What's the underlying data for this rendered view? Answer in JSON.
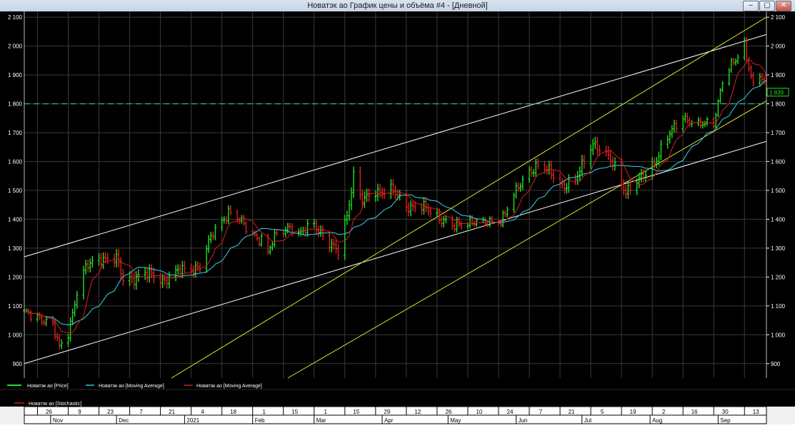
{
  "window": {
    "title": "Новатэк ао График цены и объёма #4 - [Дневной]",
    "buttons": {
      "minimize": "–",
      "restore": "▢",
      "close": "✕"
    }
  },
  "colors": {
    "background": "#000000",
    "grid": "#3a3a3a",
    "up_bar": "#22e022",
    "down_bar": "#e02020",
    "ma_fast": "#c81e1e",
    "ma_slow": "#33c3d6",
    "trend_white": "#ffffff",
    "trend_yellow": "#e3de2a",
    "level_line": "#2fb6b6"
  },
  "legend": {
    "price": "Новатэк ао [Price]",
    "ma_slow": "Новатэк ао [Moving Average]",
    "ma_fast": "Новатэк ао [Moving Average]"
  },
  "stochastic": {
    "label": "Новатэк ао [Stochastic]"
  },
  "chart_data": {
    "type": "ohlc",
    "ylim": [
      850,
      2120
    ],
    "y_ticks": [
      900,
      1000,
      1100,
      1200,
      1300,
      1400,
      1500,
      1600,
      1700,
      1800,
      1900,
      2000,
      2100
    ],
    "y_tick_labels": [
      "900",
      "1 000",
      "1 100",
      "1 200",
      "1 300",
      "1 400",
      "1 500",
      "1 600",
      "1 700",
      "1 800",
      "1 900",
      "2 000",
      "2 100"
    ],
    "last_price_label": "1 839",
    "last_price": 1839,
    "horizontal_level": 1800,
    "grid": true,
    "x_range": [
      "2020-10-20",
      "2021-09-23"
    ],
    "day_ticks": [
      {
        "date": "2020-10-26",
        "label": "26"
      },
      {
        "date": "2020-11-09",
        "label": "9"
      },
      {
        "date": "2020-11-23",
        "label": "23"
      },
      {
        "date": "2020-12-07",
        "label": "7"
      },
      {
        "date": "2020-12-21",
        "label": "21"
      },
      {
        "date": "2021-01-04",
        "label": "4"
      },
      {
        "date": "2021-01-18",
        "label": "18"
      },
      {
        "date": "2021-02-01",
        "label": "1"
      },
      {
        "date": "2021-02-15",
        "label": "15"
      },
      {
        "date": "2021-03-01",
        "label": "1"
      },
      {
        "date": "2021-03-15",
        "label": "15"
      },
      {
        "date": "2021-03-29",
        "label": "29"
      },
      {
        "date": "2021-04-12",
        "label": "12"
      },
      {
        "date": "2021-04-26",
        "label": "26"
      },
      {
        "date": "2021-05-10",
        "label": "10"
      },
      {
        "date": "2021-05-24",
        "label": "24"
      },
      {
        "date": "2021-06-07",
        "label": "7"
      },
      {
        "date": "2021-06-21",
        "label": "21"
      },
      {
        "date": "2021-07-05",
        "label": "5"
      },
      {
        "date": "2021-07-19",
        "label": "19"
      },
      {
        "date": "2021-08-02",
        "label": "2"
      },
      {
        "date": "2021-08-16",
        "label": "16"
      },
      {
        "date": "2021-08-30",
        "label": "30"
      },
      {
        "date": "2021-09-13",
        "label": "13"
      }
    ],
    "month_ticks": [
      {
        "date": "2020-11-01",
        "label": "Nov"
      },
      {
        "date": "2020-12-01",
        "label": "Dec"
      },
      {
        "date": "2021-01-01",
        "label": "2021"
      },
      {
        "date": "2021-02-01",
        "label": "Feb"
      },
      {
        "date": "2021-03-01",
        "label": "Mar"
      },
      {
        "date": "2021-04-01",
        "label": "Apr"
      },
      {
        "date": "2021-05-01",
        "label": "May"
      },
      {
        "date": "2021-06-01",
        "label": "Jun"
      },
      {
        "date": "2021-07-01",
        "label": "Jul"
      },
      {
        "date": "2021-08-01",
        "label": "Aug"
      },
      {
        "date": "2021-09-01",
        "label": "Sep"
      }
    ],
    "price_path": [
      [
        "2020-10-20",
        1070
      ],
      [
        "2020-10-28",
        1060
      ],
      [
        "2020-11-02",
        1030
      ],
      [
        "2020-11-05",
        950
      ],
      [
        "2020-11-09",
        1010
      ],
      [
        "2020-11-13",
        1150
      ],
      [
        "2020-11-17",
        1230
      ],
      [
        "2020-11-24",
        1270
      ],
      [
        "2020-12-01",
        1260
      ],
      [
        "2020-12-04",
        1190
      ],
      [
        "2020-12-14",
        1210
      ],
      [
        "2020-12-22",
        1190
      ],
      [
        "2020-12-30",
        1220
      ],
      [
        "2021-01-08",
        1240
      ],
      [
        "2021-01-14",
        1350
      ],
      [
        "2021-01-21",
        1430
      ],
      [
        "2021-01-25",
        1400
      ],
      [
        "2021-01-29",
        1370
      ],
      [
        "2021-02-05",
        1330
      ],
      [
        "2021-02-08",
        1280
      ],
      [
        "2021-02-12",
        1350
      ],
      [
        "2021-02-18",
        1380
      ],
      [
        "2021-02-22",
        1340
      ],
      [
        "2021-03-01",
        1390
      ],
      [
        "2021-03-09",
        1300
      ],
      [
        "2021-03-12",
        1290
      ],
      [
        "2021-03-16",
        1420
      ],
      [
        "2021-03-19",
        1550
      ],
      [
        "2021-03-23",
        1460
      ],
      [
        "2021-03-29",
        1500
      ],
      [
        "2021-04-05",
        1500
      ],
      [
        "2021-04-12",
        1450
      ],
      [
        "2021-04-19",
        1440
      ],
      [
        "2021-04-27",
        1410
      ],
      [
        "2021-05-04",
        1370
      ],
      [
        "2021-05-12",
        1400
      ],
      [
        "2021-05-18",
        1380
      ],
      [
        "2021-05-25",
        1400
      ],
      [
        "2021-05-31",
        1480
      ],
      [
        "2021-06-07",
        1570
      ],
      [
        "2021-06-11",
        1590
      ],
      [
        "2021-06-18",
        1550
      ],
      [
        "2021-06-22",
        1520
      ],
      [
        "2021-06-28",
        1530
      ],
      [
        "2021-07-02",
        1600
      ],
      [
        "2021-07-06",
        1670
      ],
      [
        "2021-07-12",
        1620
      ],
      [
        "2021-07-16",
        1580
      ],
      [
        "2021-07-21",
        1500
      ],
      [
        "2021-07-27",
        1530
      ],
      [
        "2021-08-02",
        1590
      ],
      [
        "2021-08-09",
        1680
      ],
      [
        "2021-08-16",
        1760
      ],
      [
        "2021-08-23",
        1720
      ],
      [
        "2021-08-30",
        1740
      ],
      [
        "2021-09-03",
        1880
      ],
      [
        "2021-09-09",
        1950
      ],
      [
        "2021-09-13",
        2010
      ],
      [
        "2021-09-17",
        1860
      ],
      [
        "2021-09-20",
        1900
      ],
      [
        "2021-09-23",
        1839
      ]
    ],
    "trend_lines": [
      {
        "color": "white",
        "from": [
          "2020-10-20",
          1270
        ],
        "to": [
          "2021-09-23",
          2040
        ]
      },
      {
        "color": "white",
        "from": [
          "2020-10-20",
          900
        ],
        "to": [
          "2021-09-23",
          1670
        ]
      },
      {
        "color": "yellow",
        "from": [
          "2020-12-26",
          850
        ],
        "to": [
          "2021-09-23",
          2100
        ]
      },
      {
        "color": "yellow",
        "from": [
          "2021-02-17",
          850
        ],
        "to": [
          "2021-09-23",
          1810
        ]
      }
    ]
  }
}
